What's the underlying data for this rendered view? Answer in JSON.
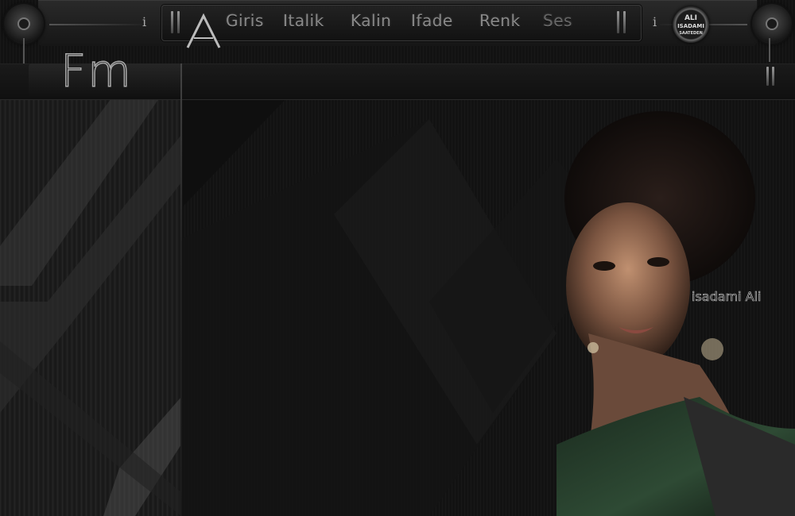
{
  "menu": {
    "items": [
      "Giris",
      "Italik",
      "Kalin",
      "Ifade",
      "Renk",
      "Ses"
    ],
    "logo_letter": "A"
  },
  "controls": {
    "info_left": "i",
    "info_right": "i"
  },
  "badge": {
    "line1": "ALI",
    "line2": "ISADAMI",
    "line3": "SAATEDEN"
  },
  "header": {
    "title": "Fm"
  },
  "image": {
    "watermark": "isadami Ali",
    "subject": "portrait-of-woman"
  },
  "colors": {
    "background": "#0d0d0d",
    "panel": "#1a1a1a",
    "menu_text": "#888888",
    "accent_dress": "#2e4a34"
  }
}
